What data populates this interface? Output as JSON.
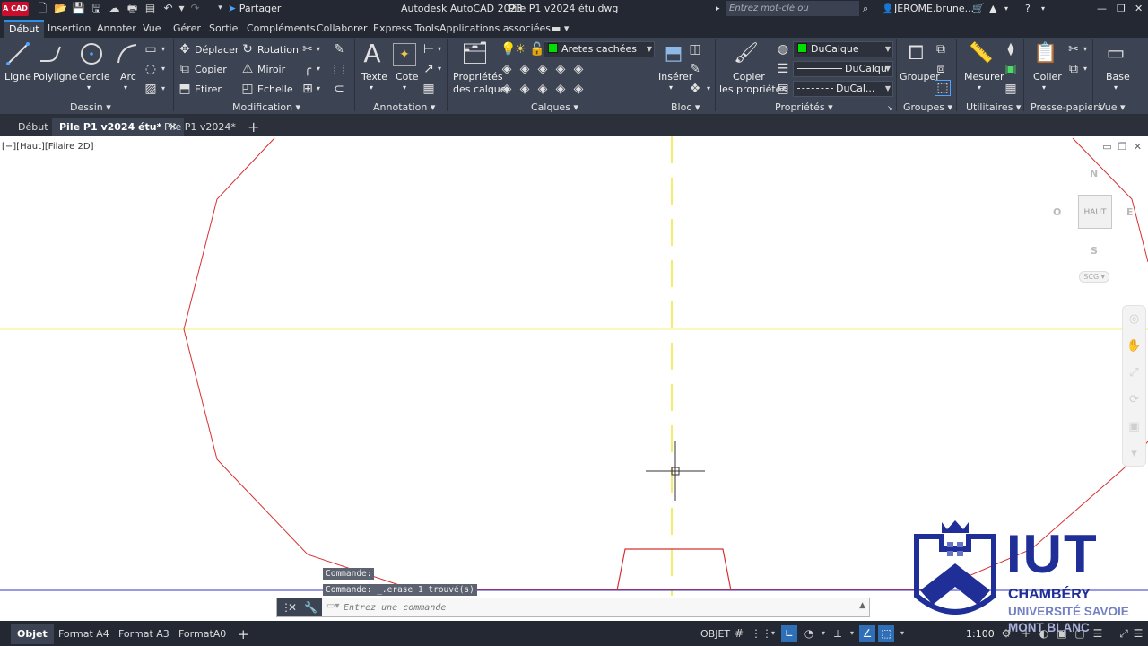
{
  "app": {
    "logo": "A CAD",
    "title": "Autodesk AutoCAD 2023",
    "filename": "Pile P1 v2024 étu.dwg",
    "share_label": "Partager",
    "search_placeholder": "Entrez mot-clé ou expression",
    "user": "JEROME.brune..."
  },
  "menu_tabs": [
    "Début",
    "Insertion",
    "Annoter",
    "Vue",
    "Gérer",
    "Sortie",
    "Compléments",
    "Collaborer",
    "Express Tools",
    "Applications associées"
  ],
  "ribbon": {
    "dessin": {
      "title": "Dessin",
      "tools": [
        "Ligne",
        "Polyligne",
        "Cercle",
        "Arc"
      ]
    },
    "modification": {
      "title": "Modification",
      "tools": [
        "Déplacer",
        "Rotation",
        "Copier",
        "Miroir",
        "Etirer",
        "Echelle"
      ]
    },
    "annotation": {
      "title": "Annotation",
      "tools": [
        "Texte",
        "Cote"
      ]
    },
    "calques": {
      "title": "Calques",
      "props_label_1": "Propriétés",
      "props_label_2": "des calque",
      "current_layer": "Aretes cachées",
      "layer_color": "#00e000"
    },
    "bloc": {
      "title": "Bloc",
      "insert_label": "Insérer"
    },
    "proprietes": {
      "title": "Propriétés",
      "copy_label_1": "Copier",
      "copy_label_2": "les propriétés",
      "color": "DuCalque",
      "linetype": "DuCalqu",
      "lineweight": "DuCal..."
    },
    "groupes": {
      "title": "Groupes",
      "group_label": "Grouper"
    },
    "utilitaires": {
      "title": "Utilitaires",
      "measure_label": "Mesurer"
    },
    "presse_papiers": {
      "title": "Presse-papiers",
      "paste_label": "Coller"
    },
    "vue": {
      "title": "Vue",
      "base_label": "Base"
    }
  },
  "doc_tabs": [
    "Début",
    "Pile P1 v2024 étu*",
    "Pile P1 v2024*"
  ],
  "viewport": {
    "label": "[−][Haut][Filaire 2D]",
    "viewcube": {
      "face": "HAUT",
      "north": "N",
      "south": "S",
      "west": "O",
      "east": "E",
      "ucs": "SCG"
    }
  },
  "command": {
    "history": [
      "Commande:",
      "Commande: _.erase 1 trouvé(s)"
    ],
    "placeholder": "Entrez une commande"
  },
  "status": {
    "layout_tabs": [
      "Objet",
      "Format A4",
      "Format A3",
      "FormatA0"
    ],
    "model_label": "OBJET",
    "scale": "1:100"
  },
  "watermark": {
    "line1": "IUT",
    "line2": "CHAMBÉRY",
    "line3": "UNIVERSITÉ SAVOIE",
    "line4": "MONT BLANC"
  }
}
